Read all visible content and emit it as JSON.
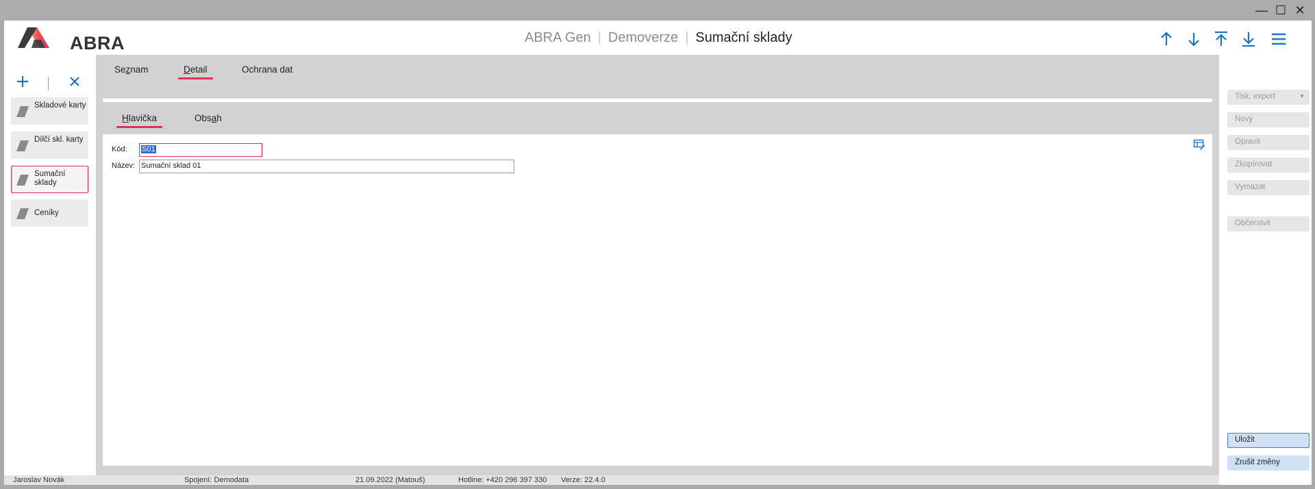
{
  "window": {
    "min": "—",
    "max": "☐",
    "close": "✕"
  },
  "header": {
    "logo_text": "ABRA",
    "breadcrumb": [
      "ABRA Gen",
      "Demoverze"
    ],
    "current": "Sumační sklady"
  },
  "left": {
    "items": [
      {
        "label": "Skladové karty"
      },
      {
        "label": "Dílčí skl. karty"
      },
      {
        "label": "Sumační sklady"
      },
      {
        "label": "Ceníky"
      }
    ]
  },
  "tabs": {
    "main": [
      {
        "pre": "Se",
        "ul": "z",
        "post": "nam"
      },
      {
        "pre": "",
        "ul": "D",
        "post": "etail"
      },
      {
        "pre": "Ochrana dat",
        "ul": "",
        "post": ""
      }
    ],
    "sub": [
      {
        "pre": "",
        "ul": "H",
        "post": "lavička"
      },
      {
        "pre": "Obs",
        "ul": "a",
        "post": "h"
      }
    ]
  },
  "form": {
    "kod_label": "Kód:",
    "kod_value": "S01",
    "nazev_label": "Název:",
    "nazev_value": "Sumační sklad 01"
  },
  "actions": {
    "tisk": "Tisk, export",
    "novy": "Nový",
    "opravit": "Opravit",
    "zkopirovat": "Zkopírovat",
    "vymazat": "Vymazat",
    "obcerstvit": "Občerstvit",
    "ulozit": "Uložit",
    "zrusit": "Zrušit změny"
  },
  "status": {
    "user": "Jaroslav Novák",
    "connection": "Spojení: Demodata",
    "date": "21.09.2022 (Matouš)",
    "hotline": "Hotline: +420 296 397 330",
    "version": "Verze: 22.4.0"
  },
  "colors": {
    "accent": "#e0305a",
    "icon_blue": "#1a73c9"
  }
}
